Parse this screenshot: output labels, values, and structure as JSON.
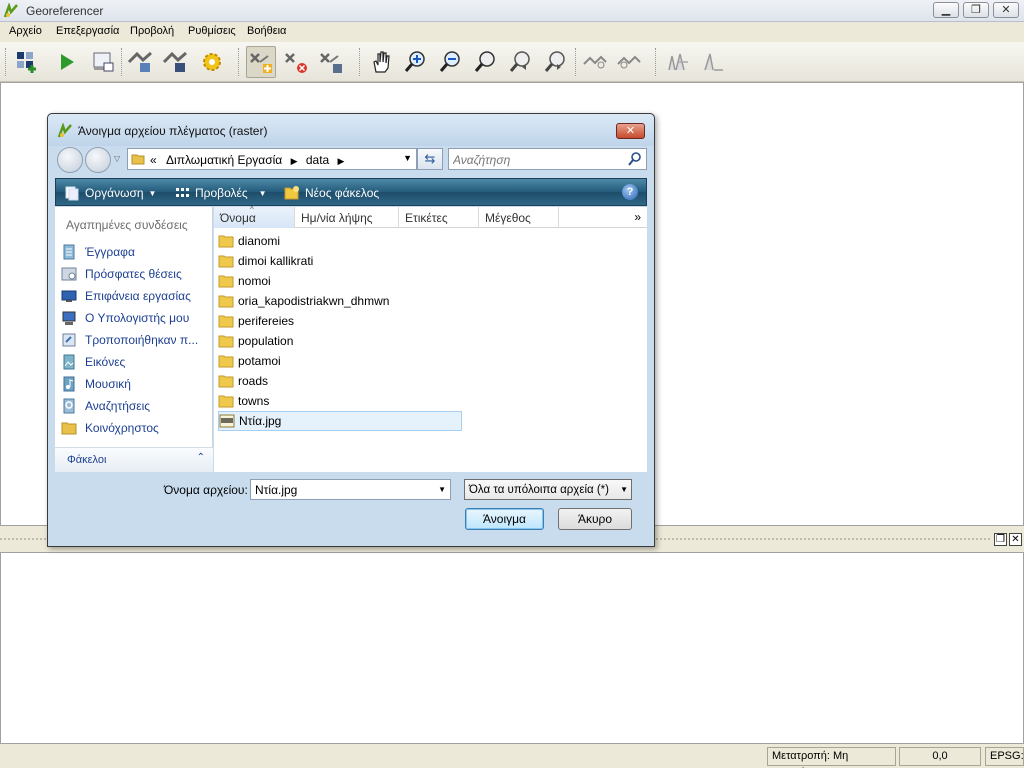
{
  "window": {
    "title": "Georeferencer",
    "controls": [
      "minimize",
      "maximize",
      "close"
    ]
  },
  "menubar": [
    "Αρχείο",
    "Επεξεργασία",
    "Προβολή",
    "Ρυθμίσεις",
    "Βοήθεια"
  ],
  "toolbar": {
    "buttons": [
      "open-raster-icon",
      "start-georeferencing-icon",
      "generate-gdal-script-icon",
      "load-gcp-points-icon",
      "save-gcp-points-icon",
      "transformation-settings-icon",
      "add-point-icon",
      "delete-point-icon",
      "move-point-icon",
      "pan-icon",
      "zoom-in-icon",
      "zoom-out-icon",
      "zoom-to-layer-icon",
      "zoom-last-icon",
      "zoom-next-icon",
      "link-georef-to-qgis-icon",
      "link-qgis-to-georef-icon",
      "full-histogram-stretch-icon",
      "local-histogram-stretch-icon"
    ],
    "pressed": [
      "add-point-icon"
    ]
  },
  "dialog": {
    "title": "Άνοιγμα αρχείου πλέγματος (raster)",
    "address": {
      "prefix": "«",
      "path": [
        "Διπλωματική Εργασία",
        "data"
      ]
    },
    "search_placeholder": "Αναζήτηση",
    "commands": {
      "organize": "Οργάνωση",
      "views": "Προβολές",
      "new_folder": "Νέος φάκελος"
    },
    "favorites_header": "Αγαπημένες συνδέσεις",
    "favorites": [
      {
        "label": "Έγγραφα",
        "icon": "documents-icon"
      },
      {
        "label": "Πρόσφατες θέσεις",
        "icon": "recent-places-icon"
      },
      {
        "label": "Επιφάνεια εργασίας",
        "icon": "desktop-icon"
      },
      {
        "label": "Ο Υπολογιστής μου",
        "icon": "computer-icon"
      },
      {
        "label": "Τροποποιήθηκαν π...",
        "icon": "recently-changed-icon"
      },
      {
        "label": "Εικόνες",
        "icon": "pictures-icon"
      },
      {
        "label": "Μουσική",
        "icon": "music-icon"
      },
      {
        "label": "Αναζητήσεις",
        "icon": "searches-icon"
      },
      {
        "label": "Κοινόχρηστος",
        "icon": "public-folder-icon"
      }
    ],
    "folders_label": "Φάκελοι",
    "columns": [
      "Όνομα",
      "Ημ/νία λήψης",
      "Ετικέτες",
      "Μέγεθος"
    ],
    "more_columns": "»",
    "files": [
      {
        "name": "dianomi",
        "type": "folder"
      },
      {
        "name": "dimoi kallikrati",
        "type": "folder"
      },
      {
        "name": "nomoi",
        "type": "folder"
      },
      {
        "name": "oria_kapodistriakwn_dhmwn",
        "type": "folder"
      },
      {
        "name": "perifereies",
        "type": "folder"
      },
      {
        "name": "population",
        "type": "folder"
      },
      {
        "name": "potamoi",
        "type": "folder"
      },
      {
        "name": "roads",
        "type": "folder"
      },
      {
        "name": "towns",
        "type": "folder"
      },
      {
        "name": "Ντία.jpg",
        "type": "jpg",
        "selected": true
      }
    ],
    "filename_label": "Όνομα αρχείου:",
    "filename_value": "Ντία.jpg",
    "filter_value": "Όλα τα υπόλοιπα αρχεία (*)",
    "open_button": "Άνοιγμα",
    "cancel_button": "Άκυρο",
    "close_glyph": "✕"
  },
  "statusbar": {
    "transform": "Μετατροπή: Μη ορισμένο",
    "coords": "0,0",
    "epsg": "EPSG:"
  },
  "colors": {
    "accent": "#245a7a",
    "link": "#1c3f91",
    "selection": "#e5f1fb"
  }
}
